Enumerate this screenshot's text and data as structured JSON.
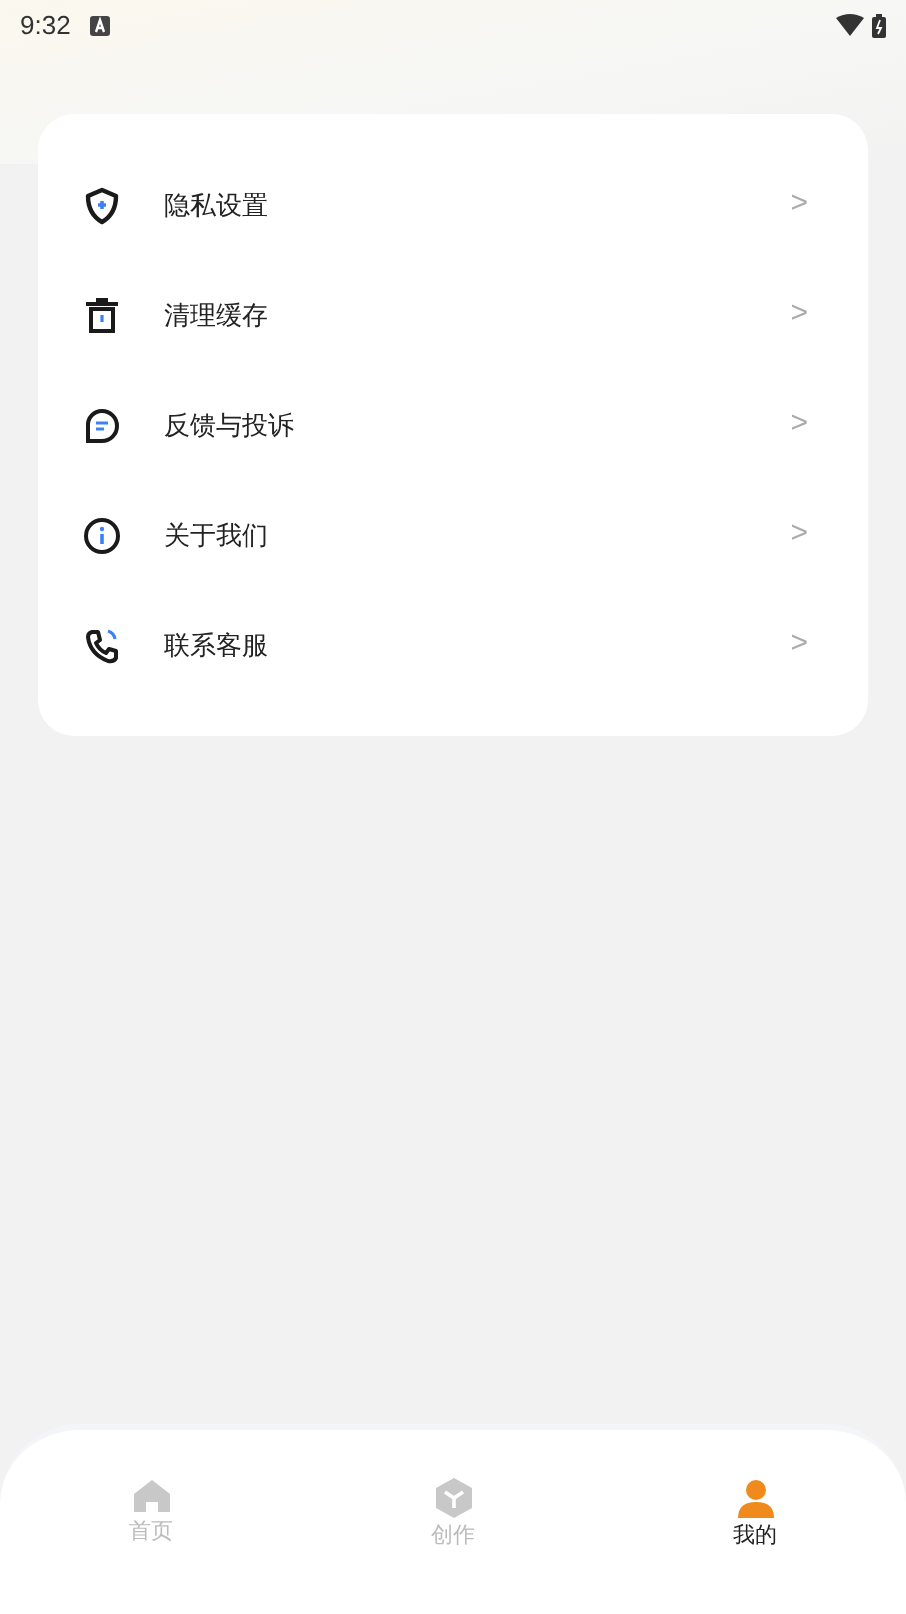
{
  "status_bar": {
    "time": "9:32"
  },
  "menu": [
    {
      "kind": "privacy",
      "label": "隐私设置",
      "chevron": ">"
    },
    {
      "kind": "cache",
      "label": "清理缓存",
      "chevron": ">"
    },
    {
      "kind": "feedback",
      "label": "反馈与投诉",
      "chevron": ">"
    },
    {
      "kind": "about",
      "label": "关于我们",
      "chevron": ">"
    },
    {
      "kind": "service",
      "label": "联系客服",
      "chevron": ">"
    }
  ],
  "tabs": [
    {
      "kind": "home",
      "label": "首页",
      "selected": false
    },
    {
      "kind": "create",
      "label": "创作",
      "selected": false
    },
    {
      "kind": "profile",
      "label": "我的",
      "selected": true
    }
  ]
}
